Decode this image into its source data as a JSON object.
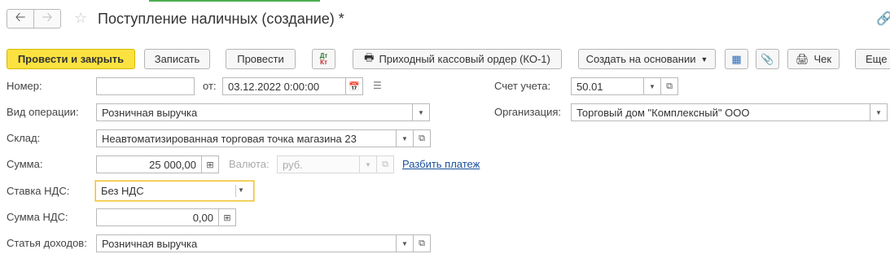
{
  "window": {
    "title": "Поступление наличных (создание) *",
    "nav": {
      "back_icon": "arrow-left-icon",
      "forward_icon": "arrow-right-icon"
    }
  },
  "toolbar": {
    "post_close": "Провести и закрыть",
    "save": "Записать",
    "post": "Провести",
    "dtkt_dt": "Дт",
    "dtkt_kt": "Кт",
    "print_order": "Приходный кассовый ордер (КО-1)",
    "create_based": "Создать на основании",
    "receipt": "Чек",
    "more": "Еще"
  },
  "form": {
    "number": {
      "label": "Номер:",
      "value": ""
    },
    "date": {
      "label": "от:",
      "value": "03.12.2022  0:00:00"
    },
    "operation": {
      "label": "Вид операции:",
      "value": "Розничная выручка"
    },
    "warehouse": {
      "label": "Склад:",
      "value": "Неавтоматизированная торговая точка магазина 23"
    },
    "amount": {
      "label": "Сумма:",
      "value": "25 000,00"
    },
    "currency": {
      "label": "Валюта:",
      "value": "руб."
    },
    "split_payment": "Разбить платеж",
    "vat_rate": {
      "label": "Ставка НДС:",
      "value": "Без НДС"
    },
    "vat_amount": {
      "label": "Сумма НДС:",
      "value": "0,00"
    },
    "income_item": {
      "label": "Статья доходов:",
      "value": "Розничная выручка"
    },
    "account": {
      "label": "Счет учета:",
      "value": "50.01"
    },
    "organization": {
      "label": "Организация:",
      "value": "Торговый дом \"Комплексный\" ООО"
    }
  },
  "colors": {
    "primary_button": "#fbe240",
    "link": "#1a4f9c",
    "focus_border": "#f1c232"
  }
}
